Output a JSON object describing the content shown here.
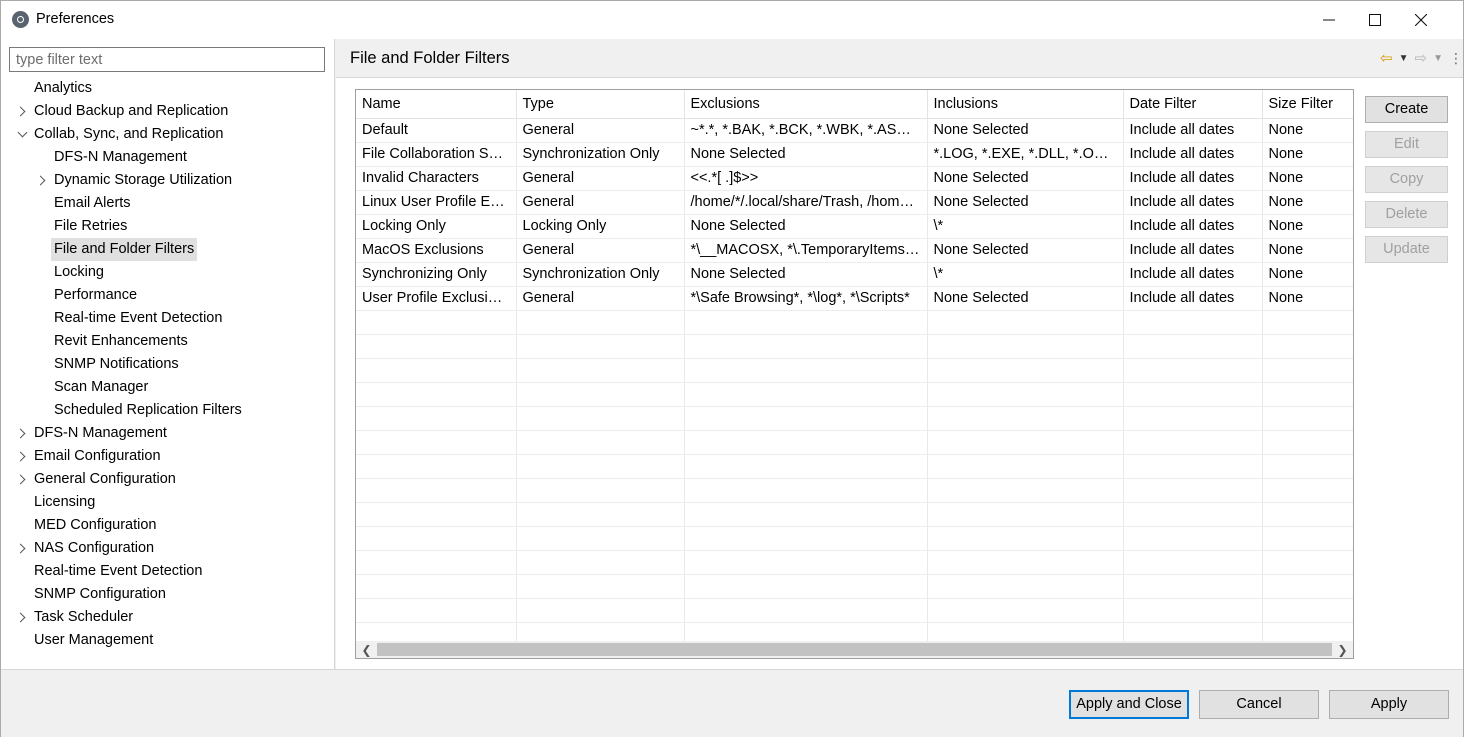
{
  "window": {
    "title": "Preferences",
    "icon": "app-logo-icon"
  },
  "filter": {
    "placeholder": "type filter text",
    "value": ""
  },
  "tree": [
    {
      "label": "Analytics",
      "level": 0,
      "twisty": "none"
    },
    {
      "label": "Cloud Backup and Replication",
      "level": 0,
      "twisty": "collapsed"
    },
    {
      "label": "Collab, Sync, and Replication",
      "level": 0,
      "twisty": "expanded"
    },
    {
      "label": "DFS-N Management",
      "level": 1,
      "twisty": "none"
    },
    {
      "label": "Dynamic Storage Utilization",
      "level": 1,
      "twisty": "collapsed"
    },
    {
      "label": "Email Alerts",
      "level": 1,
      "twisty": "none"
    },
    {
      "label": "File Retries",
      "level": 1,
      "twisty": "none"
    },
    {
      "label": "File and Folder Filters",
      "level": 1,
      "twisty": "none",
      "selected": true
    },
    {
      "label": "Locking",
      "level": 1,
      "twisty": "none"
    },
    {
      "label": "Performance",
      "level": 1,
      "twisty": "none"
    },
    {
      "label": "Real-time Event Detection",
      "level": 1,
      "twisty": "none"
    },
    {
      "label": "Revit Enhancements",
      "level": 1,
      "twisty": "none"
    },
    {
      "label": "SNMP Notifications",
      "level": 1,
      "twisty": "none"
    },
    {
      "label": "Scan Manager",
      "level": 1,
      "twisty": "none"
    },
    {
      "label": "Scheduled Replication Filters",
      "level": 1,
      "twisty": "none"
    },
    {
      "label": "DFS-N Management",
      "level": 0,
      "twisty": "collapsed"
    },
    {
      "label": "Email Configuration",
      "level": 0,
      "twisty": "collapsed"
    },
    {
      "label": "General Configuration",
      "level": 0,
      "twisty": "collapsed"
    },
    {
      "label": "Licensing",
      "level": 0,
      "twisty": "none"
    },
    {
      "label": "MED Configuration",
      "level": 0,
      "twisty": "none"
    },
    {
      "label": "NAS Configuration",
      "level": 0,
      "twisty": "collapsed"
    },
    {
      "label": "Real-time Event Detection",
      "level": 0,
      "twisty": "none"
    },
    {
      "label": "SNMP Configuration",
      "level": 0,
      "twisty": "none"
    },
    {
      "label": "Task Scheduler",
      "level": 0,
      "twisty": "collapsed"
    },
    {
      "label": "User Management",
      "level": 0,
      "twisty": "none"
    }
  ],
  "panel": {
    "title": "File and Folder Filters"
  },
  "table": {
    "columns": [
      "Name",
      "Type",
      "Exclusions",
      "Inclusions",
      "Date Filter",
      "Size Filter"
    ],
    "rows": [
      [
        "Default",
        "General",
        "~*.*, *.BAK, *.BCK, *.WBK, *.ASD, *.TMP",
        "None Selected",
        "Include all dates",
        "None"
      ],
      [
        "File Collaboration Sync",
        "Synchronization Only",
        "None Selected",
        "*.LOG, *.EXE, *.DLL, *.OTF, *.TTF",
        "Include all dates",
        "None"
      ],
      [
        "Invalid Characters",
        "General",
        "<<.*[ .]$>>",
        "None Selected",
        "Include all dates",
        "None"
      ],
      [
        "Linux User Profile Exclusions",
        "General",
        "/home/*/.local/share/Trash, /home/*/.cache",
        "None Selected",
        "Include all dates",
        "None"
      ],
      [
        "Locking Only",
        "Locking Only",
        "None Selected",
        "\\*",
        "Include all dates",
        "None"
      ],
      [
        "MacOS Exclusions",
        "General",
        "*\\__MACOSX, *\\.TemporaryItems, *\\.Trashes",
        "None Selected",
        "Include all dates",
        "None"
      ],
      [
        "Synchronizing Only",
        "Synchronization Only",
        "None Selected",
        "\\*",
        "Include all dates",
        "None"
      ],
      [
        "User Profile Exclusions",
        "General",
        "*\\Safe Browsing*, *\\log*, *\\Scripts*",
        "None Selected",
        "Include all dates",
        "None"
      ]
    ]
  },
  "buttons": {
    "create": "Create",
    "edit": "Edit",
    "copy": "Copy",
    "delete": "Delete",
    "update": "Update"
  },
  "footer": {
    "apply_close": "Apply and Close",
    "cancel": "Cancel",
    "apply": "Apply"
  },
  "colors": {
    "default_button_border": "#0078d7",
    "selection": "#e0e0e0",
    "nav_back": "#d89b00"
  }
}
